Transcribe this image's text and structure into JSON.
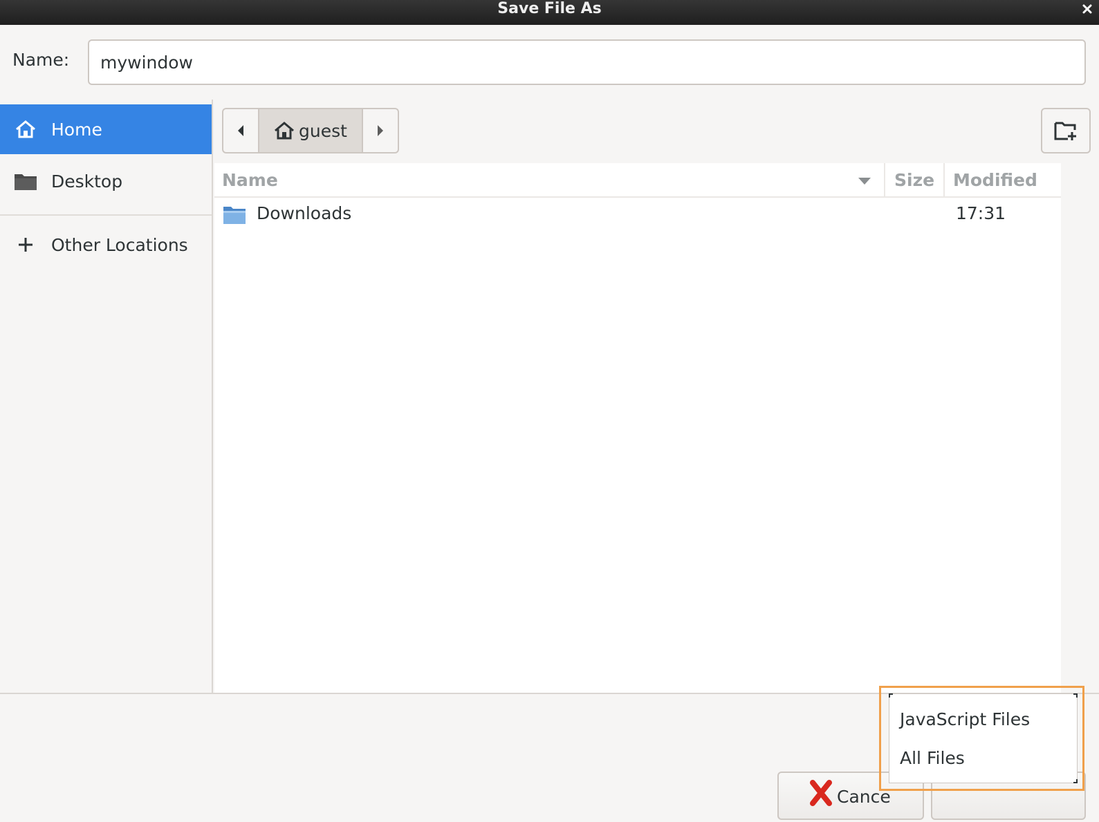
{
  "window": {
    "title": "Save File As"
  },
  "name_row": {
    "label": "Name:",
    "value": "mywindow"
  },
  "sidebar": {
    "items": [
      {
        "label": "Home",
        "icon": "home-icon",
        "active": true
      },
      {
        "label": "Desktop",
        "icon": "folder-icon",
        "active": false
      },
      {
        "label": "Other Locations",
        "icon": "plus-icon",
        "active": false
      }
    ]
  },
  "pathbar": {
    "current": "guest"
  },
  "columns": {
    "name": "Name",
    "size": "Size",
    "modified": "Modified"
  },
  "files": [
    {
      "name": "Downloads",
      "size": "",
      "modified": "17:31",
      "icon": "folder-icon"
    }
  ],
  "buttons": {
    "cancel": "Cance"
  },
  "filter_menu": {
    "options": [
      "JavaScript Files",
      "All Files"
    ]
  },
  "colors": {
    "accent": "#3584e4",
    "highlight_frame": "#f0a04b"
  }
}
